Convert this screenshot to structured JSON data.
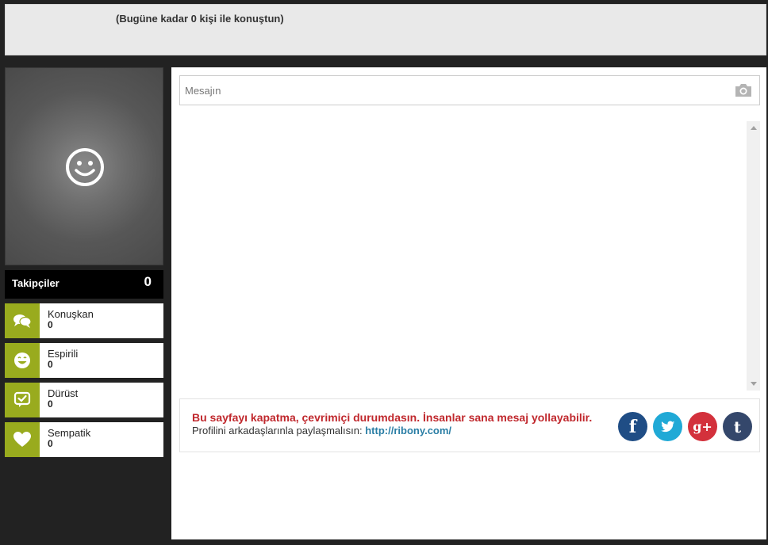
{
  "header": {
    "stat_text": "(Bugüne kadar 0 kişi ile konuştun)"
  },
  "profile": {
    "avatar_icon": "smiley-icon",
    "followers_label": "Takipçiler",
    "followers_count": "0"
  },
  "traits": [
    {
      "name": "Konuşkan",
      "value": "0",
      "icon": "chat-bubbles-icon"
    },
    {
      "name": "Espirili",
      "value": "0",
      "icon": "laughing-face-icon"
    },
    {
      "name": "Dürüst",
      "value": "0",
      "icon": "check-bubble-icon"
    },
    {
      "name": "Sempatik",
      "value": "0",
      "icon": "heart-icon"
    }
  ],
  "message": {
    "placeholder": "Mesajın",
    "camera_icon": "camera-icon"
  },
  "share": {
    "online_text": "Bu sayfayı kapatma, çevrimiçi durumdasın. İnsanlar sana mesaj yollayabilir.",
    "share_prefix": "Profilini arkadaşlarınla paylaşmalısın:",
    "profile_link": "http://ribony.com/",
    "social": [
      {
        "name": "facebook",
        "glyph": "f",
        "color": "#1f4d85"
      },
      {
        "name": "twitter",
        "glyph": "",
        "color": "#20a9d6"
      },
      {
        "name": "google-plus",
        "glyph": "g+",
        "color": "#d3313c"
      },
      {
        "name": "tumblr",
        "glyph": "t",
        "color": "#34476b"
      }
    ]
  },
  "colors": {
    "accent_green": "#99ab1e",
    "online_red": "#c0282d",
    "link_blue": "#2a7ea5"
  }
}
